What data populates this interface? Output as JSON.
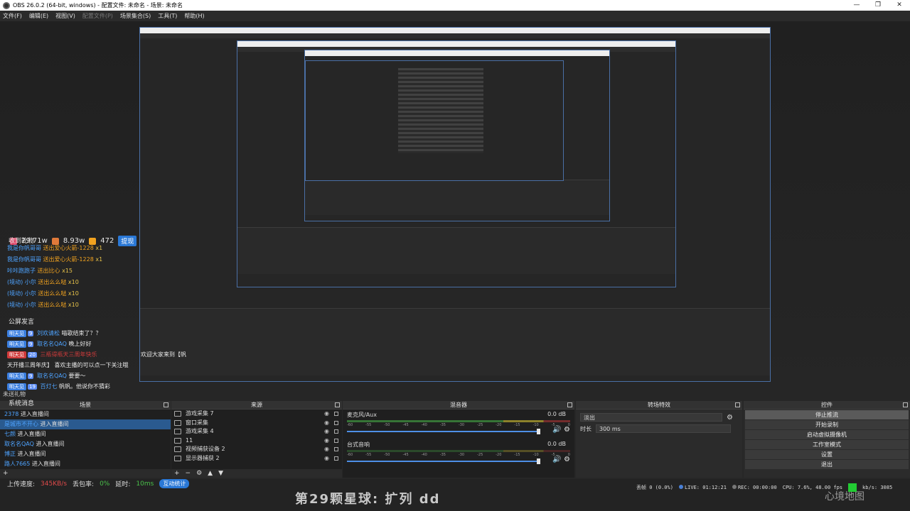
{
  "window": {
    "title": "OBS 26.0.2 (64-bit, windows) - 配置文件: 未命名 - 场景: 未命名",
    "min": "—",
    "max": "❐",
    "close": "✕"
  },
  "menu": [
    "文件(F)",
    "编辑(E)",
    "视图(V)",
    "配置文件(P)",
    "场景集合(S)",
    "工具(T)",
    "帮助(H)"
  ],
  "stats": {
    "popularity": "29.71w",
    "fans": "8.93w",
    "gifts": "472",
    "withdraw": "提现"
  },
  "gifts_section": {
    "title": "收到礼物",
    "items": [
      {
        "user": "我是你帆哥哥",
        "gift": "送出爱心火箭-1228",
        "count": "x1"
      },
      {
        "user": "我是你帆哥哥",
        "gift": "送出爱心火箭-1228",
        "count": "x1"
      },
      {
        "user": "咔咔跑跑子",
        "gift": "送出比心",
        "count": "x15"
      },
      {
        "user": "(境动) 小尔",
        "gift": "送出么么哒",
        "count": "x10"
      },
      {
        "user": "(境动) 小尔",
        "gift": "送出么么哒",
        "count": "x10"
      },
      {
        "user": "(境动) 小尔",
        "gift": "送出么么哒",
        "count": "x10"
      }
    ]
  },
  "chat_section": {
    "title": "公屏发言",
    "items": [
      {
        "badge": "明天见",
        "lvl": "9",
        "user": "刘欢请松",
        "msg": "喵歌结束了？？"
      },
      {
        "badge": "明天见",
        "lvl": "9",
        "user": "取名名QAQ",
        "msg": "晚上好好"
      },
      {
        "badge": "明天见",
        "lvl": "20",
        "user": "",
        "msg": "三瓶得瓶天三周年快乐"
      },
      {
        "badge": "",
        "lvl": "",
        "user": "天开播三周年庆】",
        "msg": "喜欢主播的可以点一下关注哦"
      },
      {
        "badge": "明天见",
        "lvl": "9",
        "user": "取名名QAQ",
        "msg": "要要～"
      },
      {
        "badge": "明天见",
        "lvl": "19",
        "user": "百灯七",
        "msg": "帆帆。他说你不猜彩"
      }
    ],
    "welcome": "欢迎大家来到【帆"
  },
  "overlay_misc": {
    "pending": "未送礼物",
    "system": "系统消息",
    "upload_label": "上传速度:",
    "upload_value": "345KB/s",
    "loss_label": "丢包率:",
    "loss_value": "0%",
    "delay_label": "延时:",
    "delay_value": "10ms",
    "interact_btn": "互动统计",
    "system_lines": [
      {
        "user": "2378",
        "msg": "进入直播间"
      },
      {
        "user": "是城市不开心",
        "msg": "进入直播间"
      },
      {
        "user": "七颜",
        "msg": "进入直播间"
      },
      {
        "user": "取名名QAQ",
        "msg": "进入直播间"
      },
      {
        "user": "博正",
        "msg": "进入直播间"
      },
      {
        "user": "路人7665",
        "msg": "进入直播间"
      }
    ]
  },
  "docks": {
    "scenes": {
      "title": "场景"
    },
    "sources": {
      "title": "来源",
      "items": [
        {
          "name": "游戏采集 7"
        },
        {
          "name": "窗口采集"
        },
        {
          "name": "游戏采集 4"
        },
        {
          "name": "11"
        },
        {
          "name": "视频捕获设备 2"
        },
        {
          "name": "显示器捕获 2"
        }
      ]
    },
    "mixer": {
      "title": "混音器",
      "channels": [
        {
          "name": "麦克风/Aux",
          "db": "0.0 dB"
        },
        {
          "name": "台式音响",
          "db": "0.0 dB"
        }
      ],
      "ticks": [
        "-60",
        "-55",
        "-50",
        "-45",
        "-40",
        "-35",
        "-30",
        "-25",
        "-20",
        "-15",
        "-10",
        "-5",
        "0"
      ]
    },
    "transitions": {
      "title": "转场特效",
      "selected": "淡出",
      "duration_label": "时长",
      "duration_value": "300 ms"
    },
    "controls": {
      "title": "控件",
      "buttons": [
        "停止推流",
        "开始录制",
        "启动虚拟摄像机",
        "工作室模式",
        "设置",
        "退出"
      ]
    }
  },
  "statusbar": {
    "dropped": "丢帧 0 (0.0%)",
    "live": "LIVE: 01:12:21",
    "rec": "REC: 00:00:00",
    "cpu": "CPU: 7.6%, 48.00 fps",
    "kbs": "kb/s: 3085"
  },
  "overlay_banner": "第29颗星球: 扩列 dd",
  "overlay_logo": "心境地图"
}
